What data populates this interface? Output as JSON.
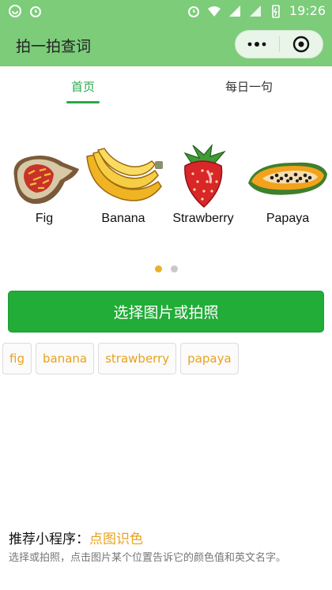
{
  "status_bar": {
    "time": "19:26"
  },
  "nav": {
    "title": "拍一拍查词"
  },
  "tabs": [
    {
      "label": "首页",
      "active": true
    },
    {
      "label": "每日一句",
      "active": false
    }
  ],
  "carousel": {
    "fruits": [
      {
        "label": "Fig",
        "icon": "fig-icon"
      },
      {
        "label": "Banana",
        "icon": "banana-icon"
      },
      {
        "label": "Strawberry",
        "icon": "strawberry-icon"
      },
      {
        "label": "Papaya",
        "icon": "papaya-icon"
      }
    ],
    "page_count": 2,
    "current_page": 1
  },
  "main_button": {
    "label": "选择图片或拍照"
  },
  "chips": [
    "fig",
    "banana",
    "strawberry",
    "papaya"
  ],
  "recommend": {
    "prefix": "推荐小程序：",
    "link": "点图识色",
    "description": "选择或拍照，点击图片某个位置告诉它的颜色值和英文名字。"
  },
  "colors": {
    "header_green": "#7ccc7a",
    "button_green": "#22ac38",
    "accent_orange": "#e8a21e",
    "tab_green": "#2aa84a"
  }
}
